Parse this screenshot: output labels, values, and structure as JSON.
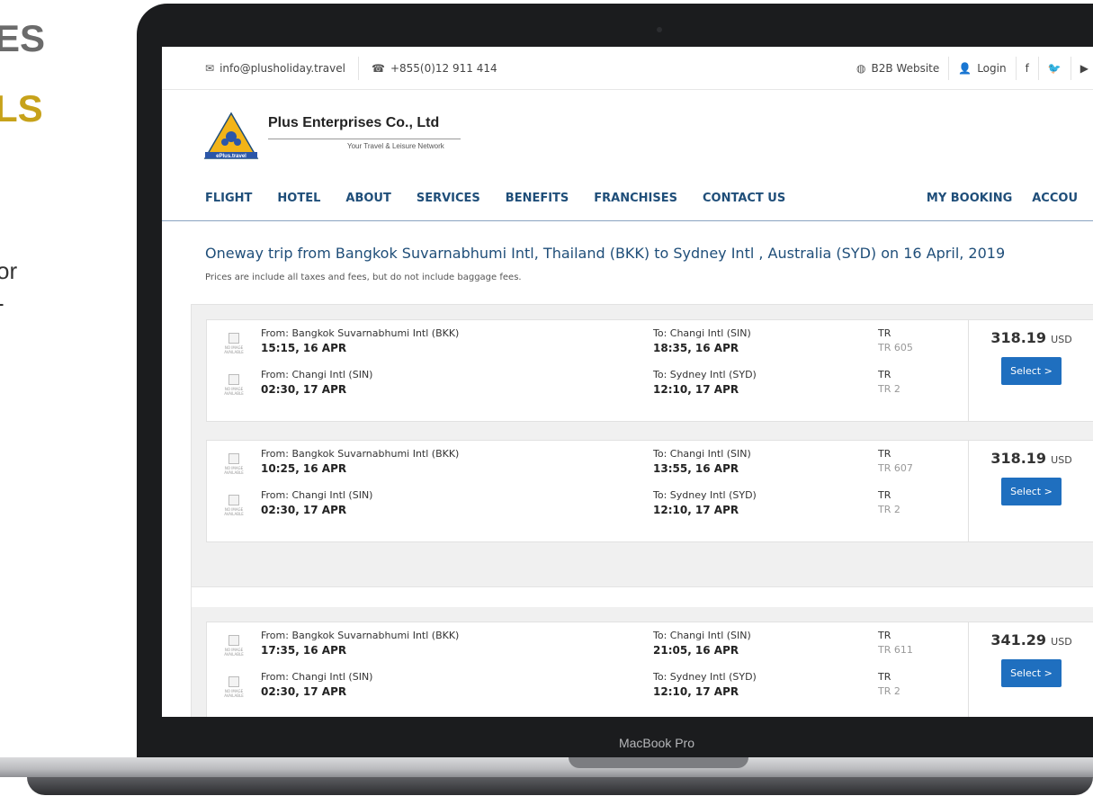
{
  "promo": {
    "line1": "ES",
    "line2": "LS",
    "line3": "or",
    "line4": "-"
  },
  "laptop": {
    "model_label": "MacBook Pro"
  },
  "topbar": {
    "email": "info@plusholiday.travel",
    "phone": "+855(0)12 911 414",
    "b2b": "B2B Website",
    "login": "Login",
    "facebook": "f",
    "twitter": "🐦",
    "youtube": "You"
  },
  "header": {
    "brand": "Plus Enterprises Co., Ltd",
    "tagline": "Your Travel & Leisure Network",
    "logo_text": "ePlus.travel"
  },
  "nav": {
    "items": [
      "FLIGHT",
      "HOTEL",
      "ABOUT",
      "SERVICES",
      "BENEFITS",
      "FRANCHISES",
      "CONTACT US"
    ],
    "right": [
      "MY BOOKING",
      "ACCOU"
    ]
  },
  "trip": {
    "title": "Oneway trip from Bangkok Suvarnabhumi Intl, Thailand (BKK) to Sydney Intl , Australia (SYD) on 16 April, 2019",
    "note": "Prices are include all taxes and fees, but do not include baggage fees."
  },
  "no_image": "NO IMAGE AVAILABLE",
  "results": [
    {
      "legs": [
        {
          "from": "From: Bangkok Suvarnabhumi Intl (BKK)",
          "dep": "15:15, 16 APR",
          "to": "To: Changi Intl (SIN)",
          "arr": "18:35, 16 APR",
          "airline": "TR",
          "flight": "TR 605"
        },
        {
          "from": "From: Changi Intl (SIN)",
          "dep": "02:30, 17 APR",
          "to": "To: Sydney Intl (SYD)",
          "arr": "12:10, 17 APR",
          "airline": "TR",
          "flight": "TR 2"
        }
      ],
      "price": "318.19",
      "currency": "USD",
      "select": "Select >"
    },
    {
      "legs": [
        {
          "from": "From: Bangkok Suvarnabhumi Intl (BKK)",
          "dep": "10:25, 16 APR",
          "to": "To: Changi Intl (SIN)",
          "arr": "13:55, 16 APR",
          "airline": "TR",
          "flight": "TR 607"
        },
        {
          "from": "From: Changi Intl (SIN)",
          "dep": "02:30, 17 APR",
          "to": "To: Sydney Intl (SYD)",
          "arr": "12:10, 17 APR",
          "airline": "TR",
          "flight": "TR 2"
        }
      ],
      "price": "318.19",
      "currency": "USD",
      "select": "Select >"
    },
    {
      "legs": [
        {
          "from": "From: Bangkok Suvarnabhumi Intl (BKK)",
          "dep": "17:35, 16 APR",
          "to": "To: Changi Intl (SIN)",
          "arr": "21:05, 16 APR",
          "airline": "TR",
          "flight": "TR 611"
        },
        {
          "from": "From: Changi Intl (SIN)",
          "dep": "02:30, 17 APR",
          "to": "To: Sydney Intl (SYD)",
          "arr": "12:10, 17 APR",
          "airline": "TR",
          "flight": "TR 2"
        }
      ],
      "price": "341.29",
      "currency": "USD",
      "select": "Select >"
    }
  ]
}
